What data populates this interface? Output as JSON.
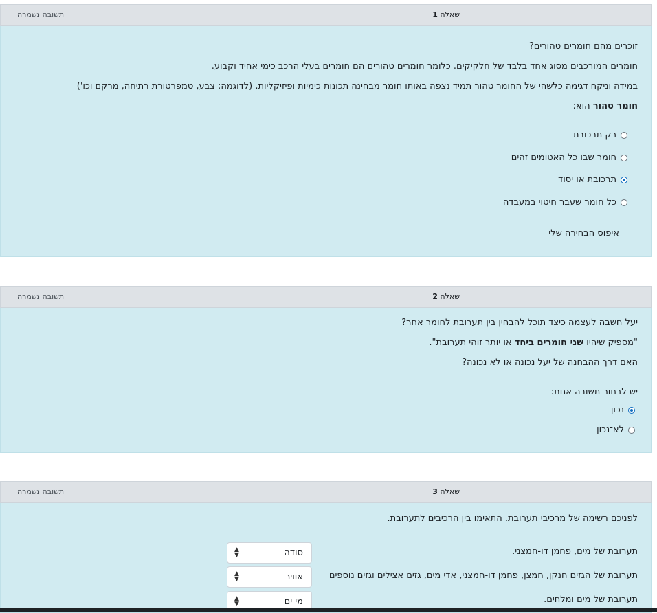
{
  "questions": [
    {
      "state": "תשובה נשמרה",
      "label": "שאלה",
      "number": "1",
      "lines": [
        "זוכרים מהם חומרים טהורים?",
        "חומרים המורכבים מסוג אחד בלבד של חלקיקים. כלומר חומרים טהורים הם חומרים בעלי הרכב כימי אחיד וקבוע.",
        " במידה וניקח דגימה כלשהי של החומר טהור תמיד נצפה באותו חומר מבחינה תכונות כימיות ופיזיקליות. (לדוגמה: צבע, טמפרטורת רתיחה, מרקם וכו')"
      ],
      "prompt_bold": "חומר טהור",
      "prompt_rest": " הוא:",
      "options": [
        {
          "label": "רק תרכובת",
          "selected": false
        },
        {
          "label": "חומר שבו כל האטומים זהים",
          "selected": false
        },
        {
          "label": "תרכובת או יסוד",
          "selected": true
        },
        {
          "label": "כל חומר שעבר חיטוי במעבדה",
          "selected": false
        }
      ],
      "reset_label": "איפוס הבחירה שלי"
    },
    {
      "state": "תשובה נשמרה",
      "label": "שאלה",
      "number": "2",
      "line1": "יעל חשבה לעצמה כיצד תוכל להבחין בין תערובת לחומר אחר?",
      "line2_a": "\"מספיק שיהיו ",
      "line2_bold": "שני חומרים ביחד",
      "line2_b": " או יותר זוהי תערובת\".",
      "line3": "האם דרך ההבחנה של יעל נכונה או לא נכונה?",
      "prompt": "יש לבחור תשובה אחת:",
      "options": [
        {
          "label": "נכון",
          "selected": true
        },
        {
          "label": "לא־נכון",
          "selected": false
        }
      ]
    },
    {
      "state": "תשובה נשמרה",
      "label": "שאלה",
      "number": "3",
      "intro": "לפניכם רשימה של מרכיבי תערובת. התאימו בין הרכיבים לתערובת.",
      "rows": [
        {
          "text": "תערובת של מים, פחמן דו-חמצני.",
          "selected": "סודה"
        },
        {
          "text": "תערובת של הגזים חנקן, חמצן, פחמן דו-חמצני, אדי מים, גזים אצילים וגזים נוספים",
          "selected": "אוויר"
        },
        {
          "text": "תערובת של מים ומלחים.",
          "selected": "מי ים"
        }
      ]
    }
  ],
  "icons": {
    "select_arrow": "sort-arrows-icon"
  }
}
